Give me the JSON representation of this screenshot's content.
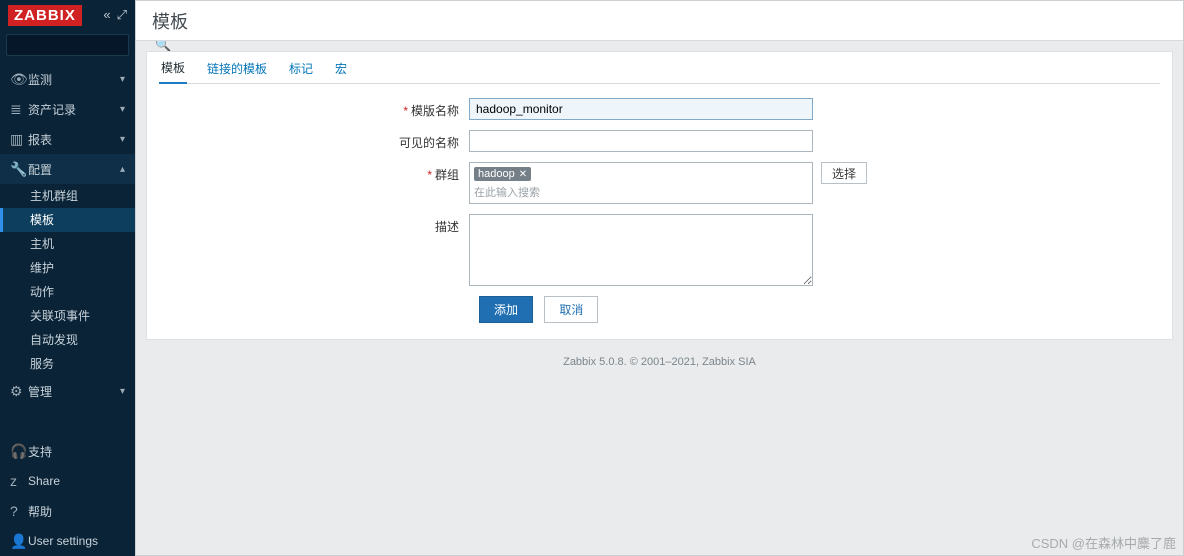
{
  "logo": "ZABBIX",
  "search": {
    "placeholder": ""
  },
  "nav": {
    "monitor": "监测",
    "inventory": "资产记录",
    "reports": "报表",
    "config": "配置",
    "admin": "管理"
  },
  "nav_config_sub": {
    "hostgroups": "主机群组",
    "templates": "模板",
    "hosts": "主机",
    "maintenance": "维护",
    "actions": "动作",
    "correlation": "关联项事件",
    "discovery": "自动发现",
    "services": "服务"
  },
  "nav_bottom": {
    "support": "支持",
    "share": "Share",
    "help": "帮助",
    "usersettings": "User settings"
  },
  "page_title": "模板",
  "tabs": {
    "template": "模板",
    "linked": "链接的模板",
    "tags": "标记",
    "macros": "宏"
  },
  "form": {
    "name_label": "模版名称",
    "name_value": "hadoop_monitor",
    "visible_label": "可见的名称",
    "visible_value": "",
    "groups_label": "群组",
    "group_tag": "hadoop",
    "group_hint": "在此输入搜索",
    "select_btn": "选择",
    "desc_label": "描述",
    "desc_value": ""
  },
  "actions": {
    "add": "添加",
    "cancel": "取消"
  },
  "footer": "Zabbix 5.0.8. © 2001–2021, Zabbix SIA",
  "watermark": "CSDN @在森林中麋了鹿"
}
